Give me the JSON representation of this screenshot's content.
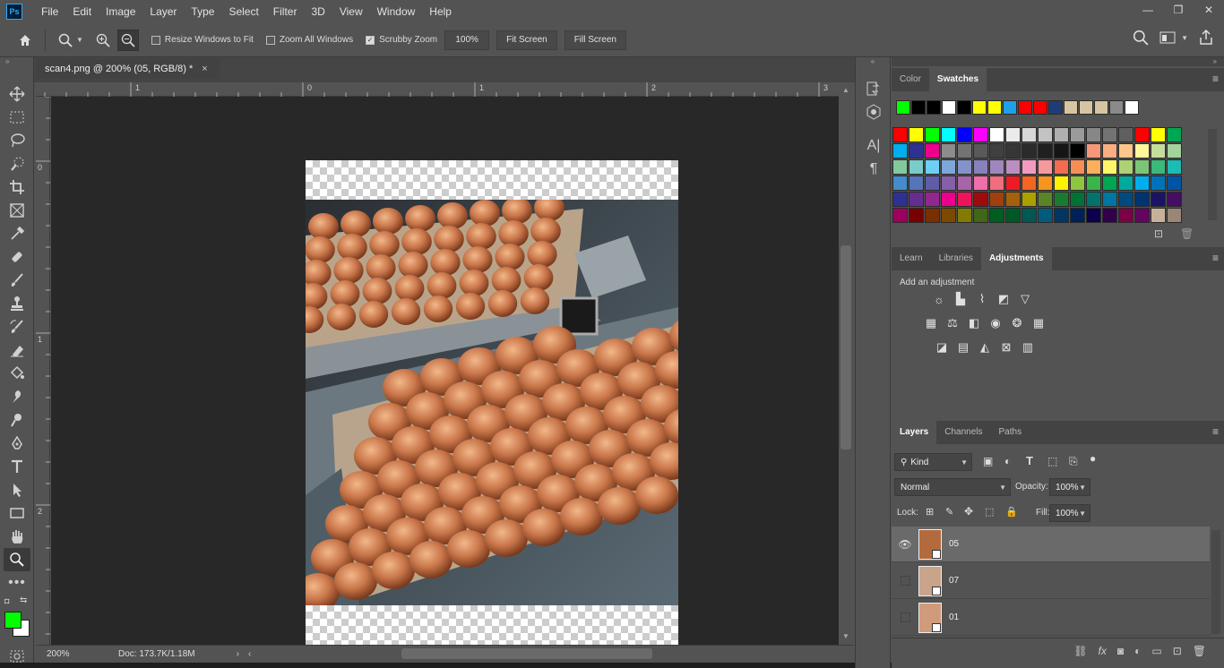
{
  "app": {
    "logo": "Ps"
  },
  "menu": [
    "File",
    "Edit",
    "Image",
    "Layer",
    "Type",
    "Select",
    "Filter",
    "3D",
    "View",
    "Window",
    "Help"
  ],
  "window_controls": {
    "minimize": "—",
    "restore": "❐",
    "close": "✕"
  },
  "options": {
    "resize_windows_to_fit": {
      "label": "Resize Windows to Fit",
      "checked": false
    },
    "zoom_all_windows": {
      "label": "Zoom All Windows",
      "checked": false
    },
    "scrubby_zoom": {
      "label": "Scrubby Zoom",
      "checked": true
    },
    "zoom_percent": "100%",
    "fit_screen": "Fit Screen",
    "fill_screen": "Fill Screen"
  },
  "document": {
    "tab_title": "scan4.png @ 200% (05, RGB/8) *",
    "close": "×"
  },
  "rulers": {
    "h": [
      "1",
      "0",
      "1",
      "2",
      "3"
    ],
    "v": [
      "0",
      "1",
      "2"
    ]
  },
  "status": {
    "zoom": "200%",
    "doc": "Doc: 173.7K/1.18M"
  },
  "colors": {
    "foreground": "#00ff00",
    "background": "#ffffff"
  },
  "swatches_panel": {
    "tabs": [
      "Color",
      "Swatches"
    ],
    "active_tab": "Swatches",
    "recent": [
      "#00ff00",
      "#000000",
      "#000000",
      "#ffffff",
      "#000000",
      "#ffff00",
      "#ffff00",
      "#1ea1e8",
      "#ff0000",
      "#ff0000",
      "#1f3c7a",
      "#d7c4a0",
      "#d7c4a0",
      "#d7c4a0",
      "#8a8a8a",
      "#ffffff"
    ],
    "grid": [
      [
        "#ff0000",
        "#ffff00",
        "#00ff00",
        "#00ffff",
        "#0000ff",
        "#ff00ff",
        "#ffffff",
        "#ebebeb",
        "#d7d7d7",
        "#c3c3c3",
        "#afafaf",
        "#9b9b9b",
        "#878787",
        "#737373",
        "#5f5f5f",
        "#ff0000",
        "#ffff00",
        "#00a651"
      ],
      [
        "#00aeef",
        "#2e3192",
        "#ec008c",
        "#8c8c8c",
        "#737373",
        "#595959",
        "#404040",
        "#363636",
        "#2b2b2b",
        "#202020",
        "#151515",
        "#000000",
        "#f7977a",
        "#f9ad81",
        "#fdc68a",
        "#fff79a",
        "#c4df9b",
        "#a3d39c"
      ],
      [
        "#82ca9d",
        "#7accc8",
        "#6dcff6",
        "#7da7d9",
        "#8393ca",
        "#8781bd",
        "#a186be",
        "#bc8dbf",
        "#f49ac2",
        "#f6989d",
        "#f26c4f",
        "#f68e56",
        "#fbaf5d",
        "#fff568",
        "#acd373",
        "#7cc576",
        "#3cb878",
        "#1cbbb4"
      ],
      [
        "#448ccb",
        "#5674b9",
        "#605ca8",
        "#8560a8",
        "#a864a8",
        "#f06eaa",
        "#f26d7d",
        "#ed1c24",
        "#f26522",
        "#f7941d",
        "#fff200",
        "#8dc63f",
        "#39b54a",
        "#00a651",
        "#00a99d",
        "#00aeef",
        "#0072bc",
        "#0054a6"
      ],
      [
        "#2e3192",
        "#662d91",
        "#92278f",
        "#ec008c",
        "#ed145b",
        "#9e0b0f",
        "#a0410d",
        "#a36209",
        "#aba000",
        "#598527",
        "#1a7b30",
        "#007236",
        "#00746b",
        "#0076a3",
        "#004a80",
        "#003471",
        "#1b1464",
        "#440e62"
      ],
      [
        "#9e005d",
        "#790000",
        "#7b2e00",
        "#7d4900",
        "#827b00",
        "#406618",
        "#005e20",
        "#005826",
        "#005952",
        "#005b7f",
        "#003663",
        "#002157",
        "#0d004c",
        "#32004b",
        "#7b0046",
        "#630460",
        "#c7b299",
        "#998675"
      ]
    ]
  },
  "adjustments_panel": {
    "tabs": [
      "Learn",
      "Libraries",
      "Adjustments"
    ],
    "active_tab": "Adjustments",
    "heading": "Add an adjustment",
    "row1": [
      "brightness-contrast",
      "levels",
      "curves",
      "exposure",
      "vibrance"
    ],
    "row2": [
      "hue-saturation",
      "color-balance",
      "black-white",
      "photo-filter",
      "channel-mixer",
      "color-lookup"
    ],
    "row3": [
      "invert",
      "posterize",
      "threshold",
      "selective-color",
      "gradient-map"
    ]
  },
  "layers_panel": {
    "tabs": [
      "Layers",
      "Channels",
      "Paths"
    ],
    "active_tab": "Layers",
    "filter_kind": "Kind",
    "blend_mode": "Normal",
    "opacity_label": "Opacity:",
    "opacity": "100%",
    "lock_label": "Lock:",
    "fill_label": "Fill:",
    "fill": "100%",
    "layers": [
      {
        "name": "05",
        "visible": true,
        "selected": true
      },
      {
        "name": "07",
        "visible": false,
        "selected": false
      },
      {
        "name": "01",
        "visible": false,
        "selected": false
      }
    ]
  }
}
